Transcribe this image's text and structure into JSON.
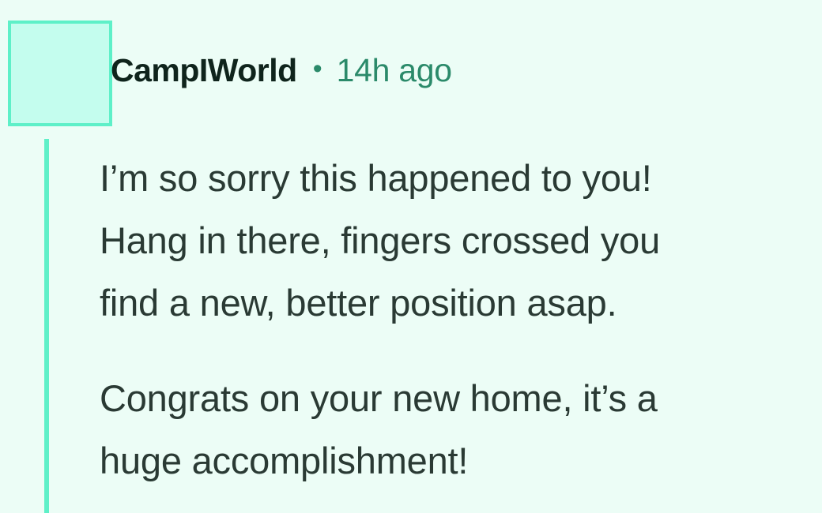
{
  "comment": {
    "author": "CampIWorld",
    "separator": "•",
    "timestamp": "14h ago",
    "paragraphs": [
      "I’m so sorry this happened to you!\nHang in there, fingers crossed you\nfind a new, better position asap.",
      "Congrats on your new home, it’s a\nhuge accomplishment!"
    ]
  },
  "colors": {
    "background": "#ecfdf6",
    "accent": "#5ef0c8",
    "avatar_fill": "#c4fdee",
    "timestamp": "#2b8a6a",
    "text": "#2a3a34"
  }
}
